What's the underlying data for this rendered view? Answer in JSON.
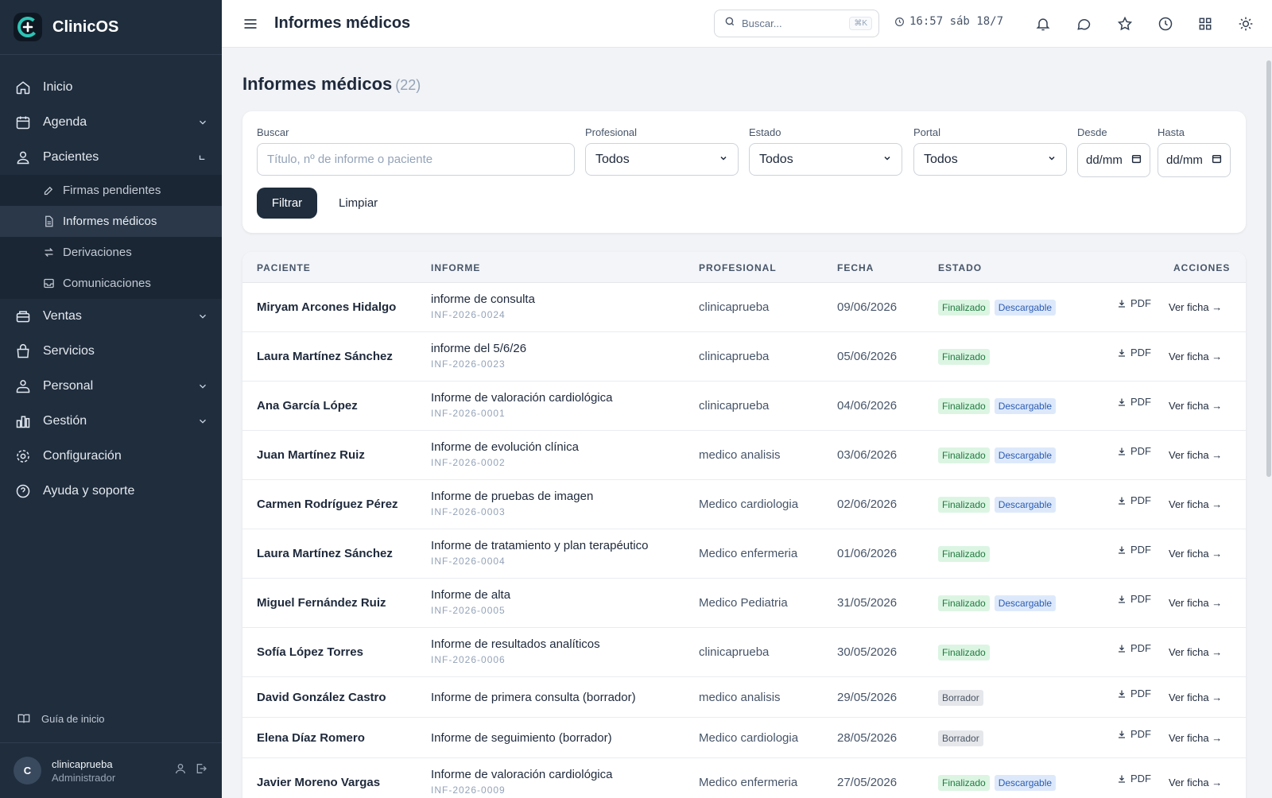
{
  "sidebar": {
    "brand": "ClinicOS",
    "nav": {
      "inicio": "Inicio",
      "agenda": "Agenda",
      "pacientes": "Pacientes",
      "ventas": "Ventas",
      "servicios": "Servicios",
      "personal": "Personal",
      "gestion": "Gestión",
      "configuracion": "Configuración",
      "ayuda": "Ayuda y soporte"
    },
    "subnav": {
      "firmas": "Firmas pendientes",
      "informes": "Informes médicos",
      "derivaciones": "Derivaciones",
      "comunicaciones": "Comunicaciones"
    },
    "guide": "Guía de inicio",
    "user": {
      "initial": "C",
      "name": "clinicaprueba",
      "role": "Administrador"
    }
  },
  "header": {
    "title": "Informes médicos",
    "search_placeholder": "Buscar...",
    "shortcut": "⌘K",
    "clock": "16:57 sáb 18/7"
  },
  "main": {
    "title": "Informes médicos",
    "count": "(22)",
    "filters": {
      "buscar_label": "Buscar",
      "buscar_placeholder": "Título, nº de informe o paciente",
      "profesional_label": "Profesional",
      "profesional_value": "Todos",
      "estado_label": "Estado",
      "estado_value": "Todos",
      "portal_label": "Portal",
      "portal_value": "Todos",
      "desde_label": "Desde",
      "desde_value": "dd/mm",
      "hasta_label": "Hasta",
      "hasta_value": "dd/mm",
      "filtrar": "Filtrar",
      "limpiar": "Limpiar"
    },
    "table": {
      "headers": {
        "paciente": "PACIENTE",
        "informe": "INFORME",
        "profesional": "PROFESIONAL",
        "fecha": "FECHA",
        "estado": "ESTADO",
        "acciones": "ACCIONES"
      },
      "pdf_label": "PDF",
      "ver_label": "Ver ficha →",
      "rows": [
        {
          "paciente": "Miryam Arcones Hidalgo",
          "titulo": "informe de consulta",
          "codigo": "INF-2026-0024",
          "profesional": "clinicaprueba",
          "fecha": "09/06/2026",
          "estado": "Finalizado",
          "portal": "Descargable"
        },
        {
          "paciente": "Laura Martínez Sánchez",
          "titulo": "informe del 5/6/26",
          "codigo": "INF-2026-0023",
          "profesional": "clinicaprueba",
          "fecha": "05/06/2026",
          "estado": "Finalizado",
          "portal": ""
        },
        {
          "paciente": "Ana García López",
          "titulo": "Informe de valoración cardiológica",
          "codigo": "INF-2026-0001",
          "profesional": "clinicaprueba",
          "fecha": "04/06/2026",
          "estado": "Finalizado",
          "portal": "Descargable"
        },
        {
          "paciente": "Juan Martínez Ruiz",
          "titulo": "Informe de evolución clínica",
          "codigo": "INF-2026-0002",
          "profesional": "medico analisis",
          "fecha": "03/06/2026",
          "estado": "Finalizado",
          "portal": "Descargable"
        },
        {
          "paciente": "Carmen Rodríguez Pérez",
          "titulo": "Informe de pruebas de imagen",
          "codigo": "INF-2026-0003",
          "profesional": "Medico cardiologia",
          "fecha": "02/06/2026",
          "estado": "Finalizado",
          "portal": "Descargable"
        },
        {
          "paciente": "Laura Martínez Sánchez",
          "titulo": "Informe de tratamiento y plan terapéutico",
          "codigo": "INF-2026-0004",
          "profesional": "Medico enfermeria",
          "fecha": "01/06/2026",
          "estado": "Finalizado",
          "portal": ""
        },
        {
          "paciente": "Miguel Fernández Ruiz",
          "titulo": "Informe de alta",
          "codigo": "INF-2026-0005",
          "profesional": "Medico Pediatria",
          "fecha": "31/05/2026",
          "estado": "Finalizado",
          "portal": "Descargable"
        },
        {
          "paciente": "Sofía López Torres",
          "titulo": "Informe de resultados analíticos",
          "codigo": "INF-2026-0006",
          "profesional": "clinicaprueba",
          "fecha": "30/05/2026",
          "estado": "Finalizado",
          "portal": ""
        },
        {
          "paciente": "David González Castro",
          "titulo": "Informe de primera consulta (borrador)",
          "codigo": "",
          "profesional": "medico analisis",
          "fecha": "29/05/2026",
          "estado": "Borrador",
          "portal": ""
        },
        {
          "paciente": "Elena Díaz Romero",
          "titulo": "Informe de seguimiento (borrador)",
          "codigo": "",
          "profesional": "Medico cardiologia",
          "fecha": "28/05/2026",
          "estado": "Borrador",
          "portal": ""
        },
        {
          "paciente": "Javier Moreno Vargas",
          "titulo": "Informe de valoración cardiológica",
          "codigo": "INF-2026-0009",
          "profesional": "Medico enfermeria",
          "fecha": "27/05/2026",
          "estado": "Finalizado",
          "portal": "Descargable"
        }
      ]
    }
  },
  "colors": {
    "sidebar": "#1f2d3d",
    "accent": "#1f2d3d",
    "final_bg": "#dcf5e3",
    "portal_bg": "#dde9fb",
    "draft_bg": "#e5e7eb"
  }
}
